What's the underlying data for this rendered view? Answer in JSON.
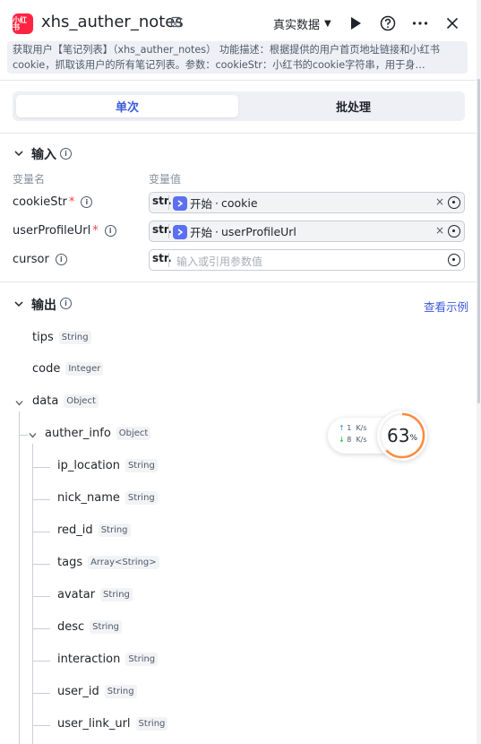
{
  "header": {
    "logo_text": "小红书",
    "title": "xhs_auther_notes",
    "mode": "真实数据",
    "icons": [
      "edit-icon",
      "run-icon",
      "help-icon",
      "more-icon",
      "close-icon"
    ]
  },
  "description": "获取用户【笔记列表】（xhs_auther_notes） 功能描述：根据提供的用户首页地址链接和小红书cookie，抓取该用户的所有笔记列表。参数：cookieStr：小红书的cookie字符串，用于身…",
  "tabs": [
    {
      "label": "单次",
      "active": true
    },
    {
      "label": "批处理",
      "active": false
    }
  ],
  "input": {
    "title": "输入",
    "col_name": "变量名",
    "col_value": "变量值",
    "vars": [
      {
        "name": "cookieStr",
        "required": true,
        "type": "str.",
        "ref_source": "开始",
        "ref_field": "cookie",
        "clear": "×"
      },
      {
        "name": "userProfileUrl",
        "required": true,
        "type": "str.",
        "ref_source": "开始",
        "ref_field": "userProfileUrl",
        "clear": "×"
      },
      {
        "name": "cursor",
        "required": false,
        "type": "str.",
        "placeholder": "输入或引用参数值"
      }
    ]
  },
  "output": {
    "title": "输出",
    "example_link": "查看示例",
    "fields": [
      {
        "name": "tips",
        "type": "String"
      },
      {
        "name": "code",
        "type": "Integer"
      },
      {
        "name": "data",
        "type": "Object"
      },
      {
        "name": "auther_info",
        "type": "Object"
      },
      {
        "name": "ip_location",
        "type": "String"
      },
      {
        "name": "nick_name",
        "type": "String"
      },
      {
        "name": "red_id",
        "type": "String"
      },
      {
        "name": "tags",
        "type": "Array<String>"
      },
      {
        "name": "avatar",
        "type": "String"
      },
      {
        "name": "desc",
        "type": "String"
      },
      {
        "name": "interaction",
        "type": "String"
      },
      {
        "name": "user_id",
        "type": "String"
      },
      {
        "name": "user_link_url",
        "type": "String"
      }
    ]
  },
  "network": {
    "up": "1",
    "up_unit": "K/s",
    "down": "8",
    "down_unit": "K/s",
    "percent": "63",
    "percent_unit": "%",
    "percent_value": 63
  },
  "colors": {
    "accent": "#3b5bdb",
    "brand": "#ff2442",
    "required": "#f53f3f",
    "gauge": "#ff8a3d"
  }
}
